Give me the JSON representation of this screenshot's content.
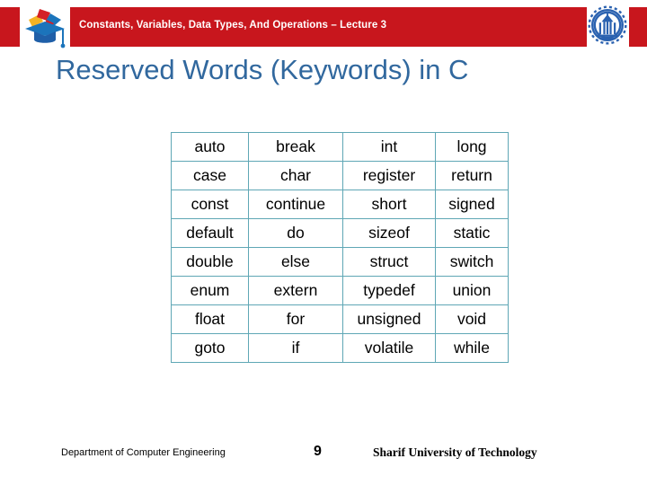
{
  "header": {
    "title": "Constants, Variables, Data Types, And Operations – Lecture 3",
    "band_color": "#C8161D",
    "left_logo_name": "graduation-cap-logo",
    "right_logo_name": "sharif-university-seal"
  },
  "slide": {
    "title": "Reserved Words (Keywords) in C",
    "title_color": "#31689E"
  },
  "keyword_table": {
    "border_color": "#5FA7B5",
    "rows": [
      [
        "auto",
        "break",
        "int",
        "long"
      ],
      [
        "case",
        "char",
        "register",
        "return"
      ],
      [
        "const",
        "continue",
        "short",
        "signed"
      ],
      [
        "default",
        "do",
        "sizeof",
        "static"
      ],
      [
        "double",
        "else",
        "struct",
        "switch"
      ],
      [
        "enum",
        "extern",
        "typedef",
        "union"
      ],
      [
        "float",
        "for",
        "unsigned",
        "void"
      ],
      [
        "goto",
        "if",
        "volatile",
        "while"
      ]
    ]
  },
  "footer": {
    "department": "Department of Computer Engineering",
    "page_number": "9",
    "university": "Sharif University of Technology"
  }
}
